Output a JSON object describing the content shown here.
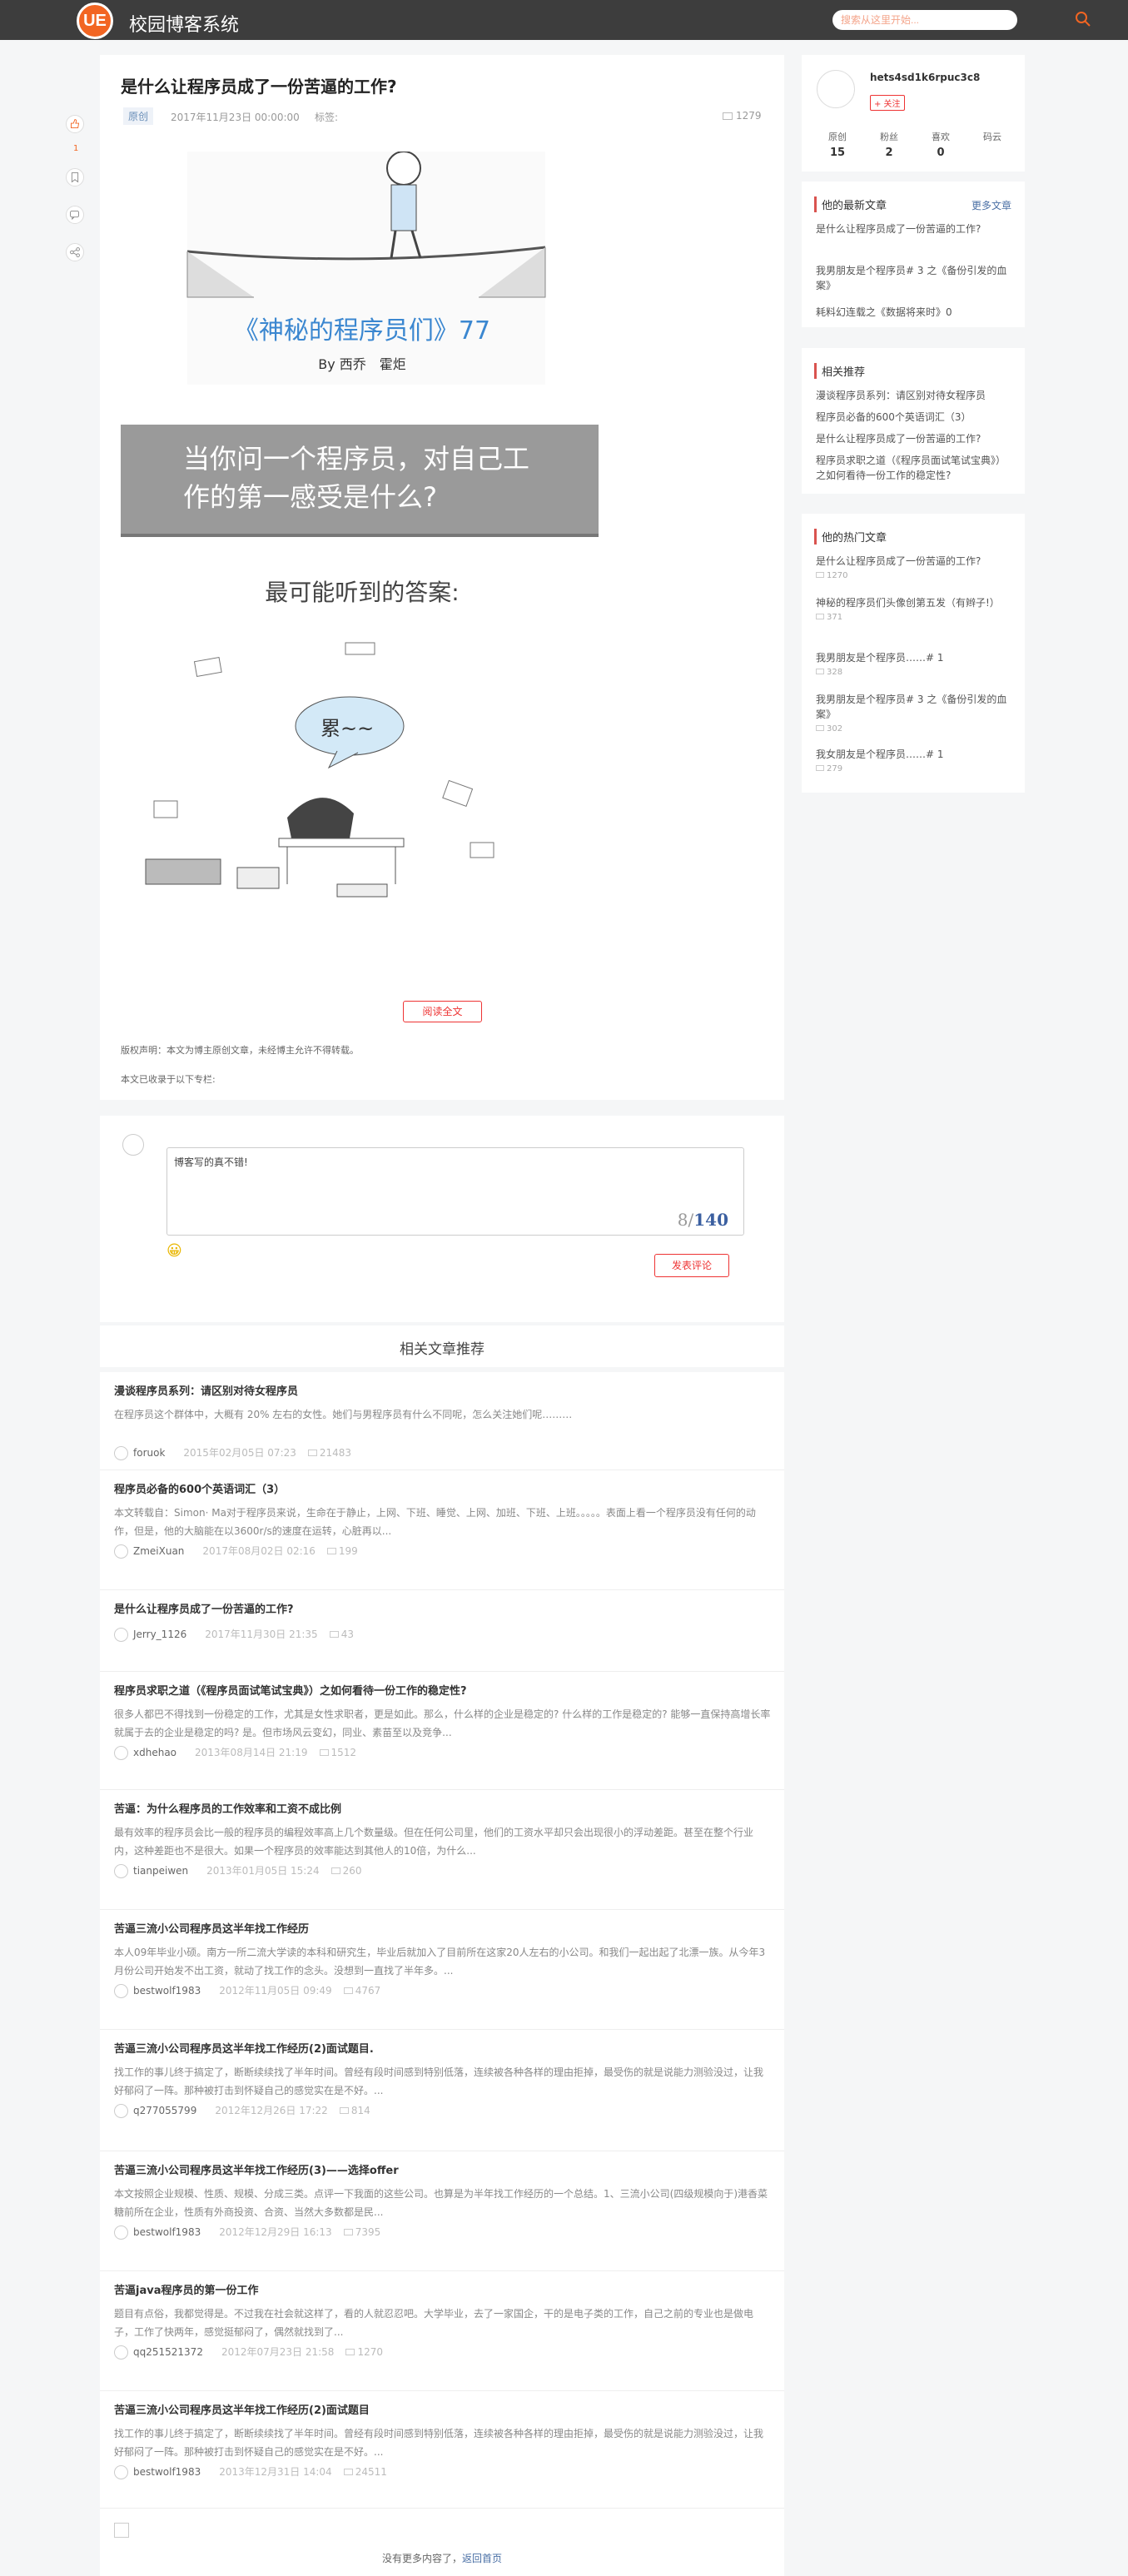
{
  "header": {
    "logo_text": "UE",
    "site_name": "校园博客系统",
    "search_placeholder": "搜索从这里开始...",
    "accent": "#f26522"
  },
  "article": {
    "title": "是什么让程序员成了一份苦逼的工作?",
    "tag": "原创",
    "date": "2017年11月23日 00:00:00",
    "labels": "标签:",
    "views": "1279",
    "like_count": "1",
    "image": {
      "title": "《神秘的程序员们》77",
      "byline": "By 西乔　霍炬",
      "banner": "当你问一个程序员，对自己工作的第一感受是什么?",
      "answer": "最可能听到的答案:",
      "bubble": "累~~"
    },
    "read_more": "阅读全文",
    "copyright": "版权声明：本文为博主原创文章，未经博主允许不得转载。",
    "collected": "本文已收录于以下专栏:"
  },
  "comment": {
    "value": "博客写的真不错!",
    "char_count": "8",
    "char_max": "140",
    "emoji": "😀",
    "submit": "发表评论"
  },
  "related": {
    "heading": "相关文章推荐",
    "items": [
      {
        "title": "漫谈程序员系列：请区别对待女程序员",
        "desc": "在程序员这个群体中，大概有 20% 左右的女性。她们与男程序员有什么不同呢，怎么关注她们呢………",
        "author": "foruok",
        "date": "2015年02月05日 07:23",
        "views": "21483"
      },
      {
        "title": "程序员必备的600个英语词汇（3）",
        "desc": "本文转载自：Simon· Ma对于程序员来说，生命在于静止，上网、下班、睡觉、上网、加班、下班、上班。。。。。表面上看一个程序员没有任何的动作，但是，他的大脑能在以3600r/s的速度在运转，心脏再以...",
        "author": "ZmeiXuan",
        "date": "2017年08月02日 02:16",
        "views": "199"
      },
      {
        "title": "是什么让程序员成了一份苦逼的工作?",
        "desc": "",
        "author": "Jerry_1126",
        "date": "2017年11月30日 21:35",
        "views": "43"
      },
      {
        "title": "程序员求职之道（《程序员面试笔试宝典》）之如何看待一份工作的稳定性?",
        "desc": "很多人都巴不得找到一份稳定的工作，尤其是女性求职者，更是如此。那么，什么样的企业是稳定的? 什么样的工作是稳定的? 能够一直保持高增长率就属于去的企业是稳定的吗? 是。但市场风云变幻，同业、素苗至以及竞争...",
        "author": "xdhehao",
        "date": "2013年08月14日 21:19",
        "views": "1512"
      },
      {
        "title": "苦逼：为什么程序员的工作效率和工资不成比例",
        "desc": "最有效率的程序员会比一般的程序员的编程效率高上几个数量级。但在任何公司里，他们的工资水平却只会出现很小的浮动差距。甚至在整个行业内，这种差距也不是很大。如果一个程序员的效率能达到其他人的10倍，为什么...",
        "author": "tianpeiwen",
        "date": "2013年01月05日 15:24",
        "views": "260"
      },
      {
        "title": "苦逼三流小公司程序员这半年找工作经历",
        "desc": "本人09年毕业小硕。南方一所二流大学读的本科和研究生，毕业后就加入了目前所在这家20人左右的小公司。和我们一起出起了北漂一族。从今年3月份公司开始发不出工资，就动了找工作的念头。没想到一直找了半年多。...",
        "author": "bestwolf1983",
        "date": "2012年11月05日 09:49",
        "views": "4767"
      },
      {
        "title": "苦逼三流小公司程序员这半年找工作经历(2)面试题目.",
        "desc": "找工作的事儿终于搞定了，断断续续找了半年时间。曾经有段时间感到特别低落，连续被各种各样的理由拒掉，最受伤的就是说能力测验没过，让我好郁闷了一阵。那种被打击到怀疑自己的感觉实在是不好。...",
        "author": "q277055799",
        "date": "2012年12月26日 17:22",
        "views": "814"
      },
      {
        "title": "苦逼三流小公司程序员这半年找工作经历(3)——选择offer",
        "desc": "本文按照企业规模、性质、规模、分成三类。点评一下我面的这些公司。也算是为半年找工作经历的一个总结。1、三流小公司(四级规模向于)港香菜糖前所在企业，性质有外商投资、合资、当然大多数都是民...",
        "author": "bestwolf1983",
        "date": "2012年12月29日 16:13",
        "views": "7395"
      },
      {
        "title": "苦逼java程序员的第一份工作",
        "desc": "题目有点俗，我都觉得是。不过我在社会就这样了，看的人就忍忍吧。大学毕业，去了一家国企，干的是电子类的工作，自己之前的专业也是做电子，工作了快两年，感觉挺郁闷了，偶然就找到了...",
        "author": "qq251521372",
        "date": "2012年07月23日 21:58",
        "views": "1270"
      },
      {
        "title": "苦逼三流小公司程序员这半年找工作经历(2)面试题目",
        "desc": "找工作的事儿终于搞定了，断断续续找了半年时间。曾经有段时间感到特别低落，连续被各种各样的理由拒掉，最受伤的就是说能力测验没过，让我好郁闷了一阵。那种被打击到怀疑自己的感觉实在是不好。...",
        "author": "bestwolf1983",
        "date": "2013年12月31日 14:04",
        "views": "24511"
      }
    ],
    "end_text": "没有更多内容了，",
    "back_top": "返回首页"
  },
  "sidebar": {
    "profile": {
      "name": "hets4sd1k6rpuc3c8",
      "follow": "+ 关注",
      "stats": [
        {
          "label": "原创",
          "value": "15"
        },
        {
          "label": "粉丝",
          "value": "2"
        },
        {
          "label": "喜欢",
          "value": "0"
        },
        {
          "label": "码云",
          "value": ""
        }
      ]
    },
    "latest": {
      "title": "他的最新文章",
      "more": "更多文章",
      "items": [
        "是什么让程序员成了一份苦逼的工作?",
        "我男朋友是个程序员# 3 之《备份引发的血案》",
        "耗料幻连载之《数据将来时》0"
      ]
    },
    "recommend": {
      "title": "相关推荐",
      "items": [
        "漫谈程序员系列：请区别对待女程序员",
        "程序员必备的600个英语词汇（3）",
        "是什么让程序员成了一份苦逼的工作?",
        "程序员求职之道（《程序员面试笔试宝典》）之如何看待一份工作的稳定性?"
      ]
    },
    "hot": {
      "title": "他的热门文章",
      "items": [
        {
          "title": "是什么让程序员成了一份苦逼的工作?",
          "views": "1270"
        },
        {
          "title": "神秘的程序员们头像创第五发（有辫子!）",
          "views": "371"
        },
        {
          "title": "我男朋友是个程序员……# 1",
          "views": "328"
        },
        {
          "title": "我男朋友是个程序员# 3 之《备份引发的血案》",
          "views": "302"
        },
        {
          "title": "我女朋友是个程序员……# 1",
          "views": "279"
        }
      ]
    }
  }
}
